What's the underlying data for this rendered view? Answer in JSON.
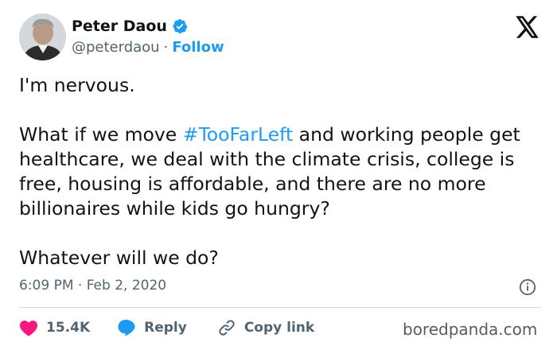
{
  "author": {
    "name": "Peter Daou",
    "handle": "@peterdaou",
    "separator": "·",
    "follow_label": "Follow"
  },
  "tweet": {
    "line1": "I'm nervous.",
    "para_prefix": "What if we move ",
    "hashtag": "#TooFarLeft",
    "para_suffix": " and working people get healthcare, we deal with the climate crisis, college is free, housing is affordable, and there are no more billionaires while kids go hungry?",
    "closing": "Whatever will we do?"
  },
  "timestamp": "6:09 PM · Feb 2, 2020",
  "actions": {
    "likes": "15.4K",
    "reply_label": "Reply",
    "copy_link_label": "Copy link"
  },
  "watermark": "boredpanda.com",
  "colors": {
    "accent": "#1d9bf0",
    "like": "#f91880",
    "text": "#0f1419",
    "muted": "#536471"
  },
  "icons": {
    "verified": "verified-badge-icon",
    "platform": "x-logo-icon",
    "info": "info-icon",
    "like": "heart-icon",
    "reply": "reply-bubble-icon",
    "copy": "link-icon"
  }
}
